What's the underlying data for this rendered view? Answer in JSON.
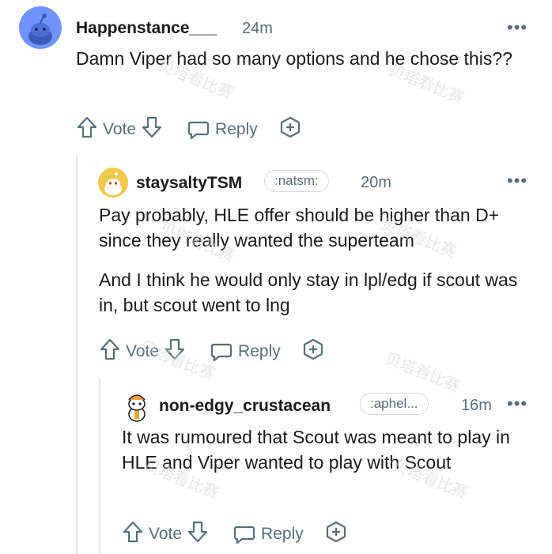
{
  "comments": [
    {
      "username": "Happenstance___",
      "time": "24m",
      "flair": "",
      "body": [
        "Damn Viper had so many options and he chose this??"
      ],
      "actions": {
        "vote": "Vote",
        "reply": "Reply"
      }
    },
    {
      "username": "staysaltyTSM",
      "time": "20m",
      "flair": ":natsm:",
      "body": [
        "Pay probably, HLE offer should be higher than D+ since they really wanted the superteam",
        "And I think he would only stay in lpl/edg if scout was in, but scout went to lng"
      ],
      "actions": {
        "vote": "Vote",
        "reply": "Reply"
      }
    },
    {
      "username": "non-edgy_crustacean",
      "time": "16m",
      "flair": ":aphel...",
      "body": [
        "It was rumoured that Scout was meant to play in HLE and Viper wanted to play with Scout"
      ],
      "actions": {
        "vote": "Vote",
        "reply": "Reply"
      }
    }
  ],
  "watermark": "贝塔看比赛",
  "more_glyph": "•••",
  "colors": {
    "text": "#1a1a1b",
    "meta": "#576f76",
    "avatar1": "#7193ff"
  }
}
